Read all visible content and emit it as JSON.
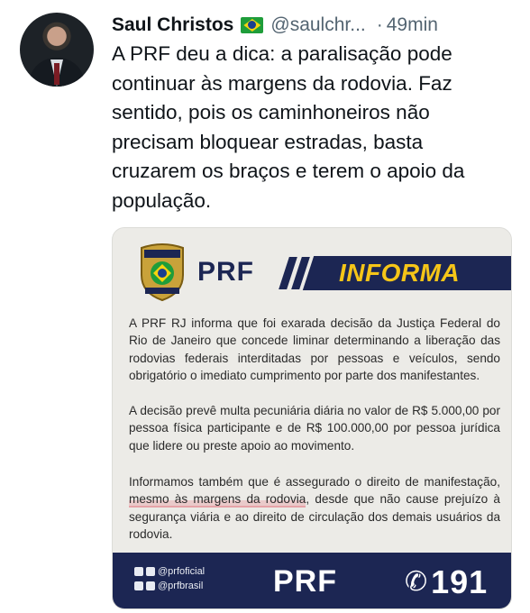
{
  "tweet": {
    "author_name": "Saul Christos",
    "handle": "@saulchr...",
    "separator": "·",
    "time": "49min",
    "text": "A PRF deu a dica: a paralisação pode continuar às margens da rodovia. Faz sentido, pois os caminhoneiros não precisam bloquear estradas, basta cruzarem os braços e terem o apoio da população."
  },
  "image": {
    "header_prf": "PRF",
    "header_informa": "INFORMA",
    "paragraph1": "A PRF RJ informa que foi exarada decisão da Justiça Federal do Rio de Janeiro que concede liminar determinando a liberação das rodovias federais interditadas por pessoas e veículos, sendo obrigatório o imediato cumprimento por parte dos manifestantes.",
    "paragraph2": "A decisão prevê multa pecuniária diária no valor de R$ 5.000,00 por pessoa física participante e de R$ 100.000,00 por pessoa jurídica que lidere ou preste apoio ao movimento.",
    "paragraph3_before": "Informamos também que é assegurado o direito de manifestação, ",
    "paragraph3_highlight": "mesmo às margens da rodovia",
    "paragraph3_after": ", desde que não cause prejuízo à segurança viária e ao direito de circulação dos demais usuários da rodovia.",
    "social_1": "@prfoficial",
    "social_2": "@prfbrasil",
    "footer_prf": "PRF",
    "footer_number": "191"
  },
  "colors": {
    "brand_navy": "#1c2653",
    "brand_yellow": "#f5c518",
    "handle_gray": "#536471"
  }
}
